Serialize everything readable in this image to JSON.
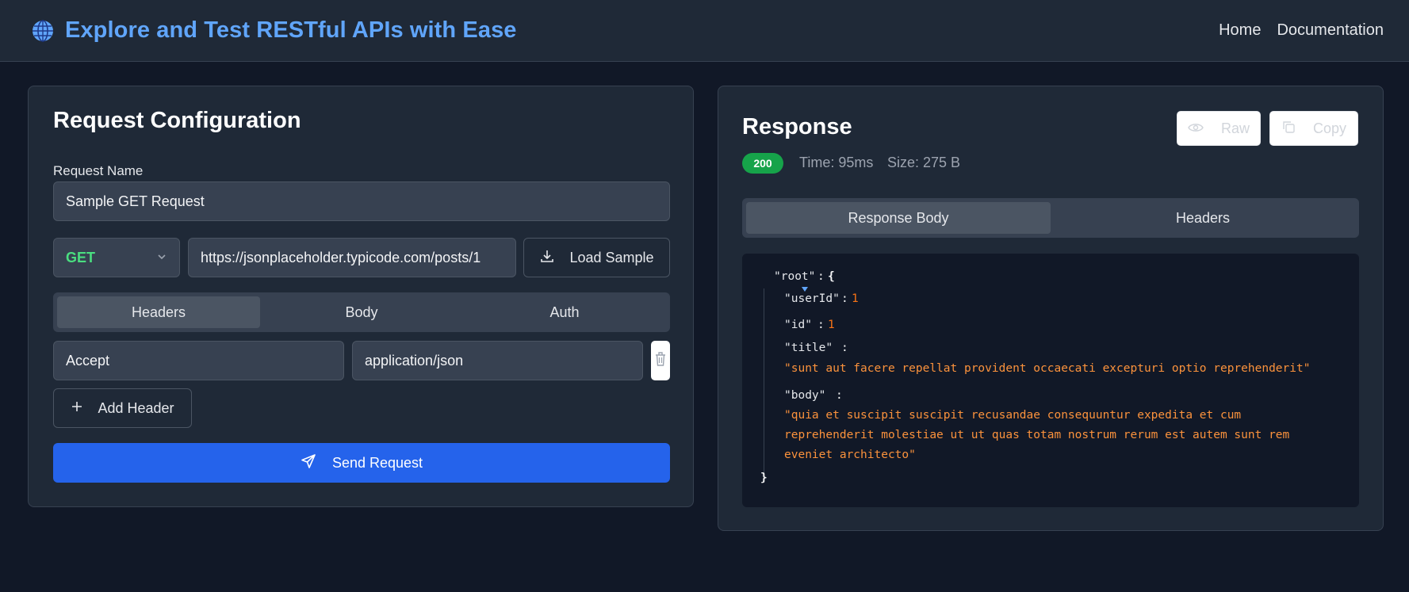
{
  "header": {
    "title": "Explore and Test RESTful APIs with Ease",
    "nav": [
      "Home",
      "Documentation"
    ]
  },
  "request": {
    "title": "Request Configuration",
    "name_label": "Request Name",
    "name_value": "Sample GET Request",
    "method": "GET",
    "url": "https://jsonplaceholder.typicode.com/posts/1",
    "load_sample_label": "Load Sample",
    "tabs": [
      {
        "label": "Headers",
        "active": true
      },
      {
        "label": "Body",
        "active": false
      },
      {
        "label": "Auth",
        "active": false
      }
    ],
    "header_key": "Accept",
    "header_value": "application/json",
    "add_header_label": "Add Header",
    "send_label": "Send Request"
  },
  "response": {
    "title": "Response",
    "raw_label": "Raw",
    "copy_label": "Copy",
    "status": "200",
    "time": "Time: 95ms",
    "size": "Size: 275 B",
    "tabs": [
      {
        "label": "Response Body",
        "active": true
      },
      {
        "label": "Headers",
        "active": false
      }
    ],
    "json": {
      "root_key": "\"root\"",
      "open_brace": "{",
      "close_brace": "}",
      "colon": ":",
      "userId_key": "\"userId\"",
      "userId_value": "1",
      "id_key": "\"id\"",
      "id_value": "1",
      "title_key": "\"title\"",
      "title_value": "\"sunt aut facere repellat provident occaecati excepturi optio reprehenderit\"",
      "body_key": "\"body\"",
      "body_line1": "\"quia et suscipit suscipit recusandae consequuntur expedita et cum",
      "body_line2": "reprehenderit molestiae ut ut quas totam nostrum rerum est autem sunt rem",
      "body_line3": "eveniet architecto\""
    }
  },
  "colors": {
    "background": "#111827",
    "panel": "#1f2937",
    "accent": "#60a5fa",
    "primary_button": "#2563eb",
    "method_get": "#4ade80",
    "status_ok": "#16a34a",
    "json_value": "#f97316"
  },
  "icons": [
    "globe-icon",
    "chevron-down-icon",
    "download-icon",
    "plus-icon",
    "send-icon",
    "trash-icon",
    "eye-icon",
    "copy-icon",
    "caret-down-icon"
  ]
}
